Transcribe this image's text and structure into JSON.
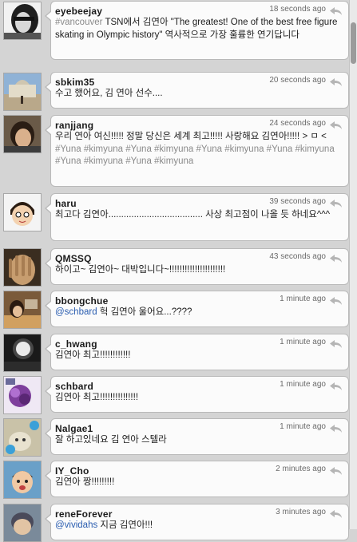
{
  "timeline": {
    "tweets": [
      {
        "user": "eyebeejay",
        "time": "18 seconds ago",
        "segments": [
          {
            "t": "#vancouver",
            "k": "hash"
          },
          {
            "t": " TSN에서  김연아 \"The greatest! One of the best free figure skating in Olympic history\" 역사적으로 가장 훌륭한 연기답니다",
            "k": "plain"
          }
        ]
      },
      {
        "user": "sbkim35",
        "time": "20 seconds ago",
        "segments": [
          {
            "t": "수고 했어요, 김 연아 선수....",
            "k": "plain"
          }
        ]
      },
      {
        "user": "ranjjang",
        "time": "24 seconds ago",
        "segments": [
          {
            "t": "우리 연아 여신!!!!! 정말 당신은 세계 최고!!!!! 사랑해요 김연아!!!!! > ㅁ < ",
            "k": "plain"
          },
          {
            "t": "#Yuna #kimyuna #Yuna #kimyuna #Yuna #kimyuna #Yuna #kimyuna #Yuna #kimyuna #Yuna #kimyuna",
            "k": "hash"
          }
        ]
      },
      {
        "user": "haru",
        "time": "39 seconds ago",
        "segments": [
          {
            "t": "최고다 김연아..................................... 사상 최고점이 나올 듯 하네요^^^",
            "k": "plain"
          }
        ]
      },
      {
        "user": "QMSSQ",
        "time": "43 seconds ago",
        "segments": [
          {
            "t": "하이고~ 김연아~ 대박입니다~!!!!!!!!!!!!!!!!!!!!!!",
            "k": "plain"
          }
        ]
      },
      {
        "user": "bbongchue",
        "time": "1 minute ago",
        "segments": [
          {
            "t": "@schbard",
            "k": "mention"
          },
          {
            "t": " 헉 김연아 울어요...????",
            "k": "plain"
          }
        ]
      },
      {
        "user": "c_hwang",
        "time": "1 minute ago",
        "segments": [
          {
            "t": "김연아 최고!!!!!!!!!!!!",
            "k": "plain"
          }
        ]
      },
      {
        "user": "schbard",
        "time": "1 minute ago",
        "segments": [
          {
            "t": "김연아 최고!!!!!!!!!!!!!!!",
            "k": "plain"
          }
        ]
      },
      {
        "user": "Nalgae1",
        "time": "1 minute ago",
        "segments": [
          {
            "t": "잘 하고있네요 김 연아 스텔라",
            "k": "plain"
          }
        ]
      },
      {
        "user": "IY_Cho",
        "time": "2 minutes ago",
        "segments": [
          {
            "t": "김연아 짱!!!!!!!!!",
            "k": "plain"
          }
        ]
      },
      {
        "user": "reneForever",
        "time": "3 minutes ago",
        "segments": [
          {
            "t": "@vividahs",
            "k": "mention"
          },
          {
            "t": " 지금 김연아!!!",
            "k": "plain"
          }
        ]
      }
    ]
  },
  "colors": {
    "hashtag": "#8a8a8a",
    "mention": "#2a5db0",
    "background": "#d4d4d4"
  },
  "icons": {
    "reply": "reply-arrow-icon"
  }
}
